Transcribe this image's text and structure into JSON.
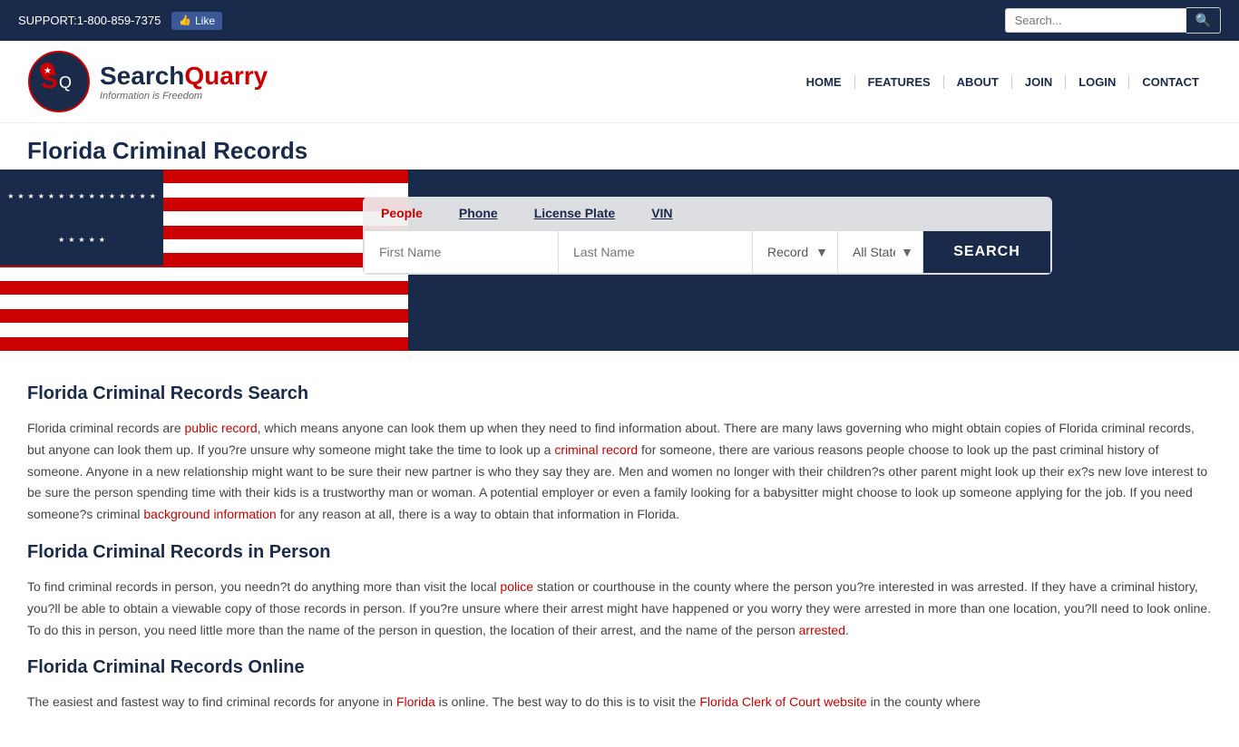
{
  "topbar": {
    "support_text": "SUPPORT:1-800-859-7375",
    "fb_like_label": "Like",
    "search_placeholder": "Search..."
  },
  "header": {
    "logo_title_part1": "Search",
    "logo_title_part2": "Quarry",
    "logo_subtitle": "Information is Freedom",
    "nav": [
      {
        "label": "HOME",
        "id": "home"
      },
      {
        "label": "FEATURES",
        "id": "features"
      },
      {
        "label": "ABOUT",
        "id": "about"
      },
      {
        "label": "JOIN",
        "id": "join"
      },
      {
        "label": "LOGIN",
        "id": "login"
      },
      {
        "label": "CONTACT",
        "id": "contact"
      }
    ]
  },
  "page": {
    "title": "Florida Criminal Records"
  },
  "search_widget": {
    "tabs": [
      {
        "label": "People",
        "id": "people",
        "active": true
      },
      {
        "label": "Phone",
        "id": "phone",
        "active": false
      },
      {
        "label": "License Plate",
        "id": "license-plate",
        "active": false
      },
      {
        "label": "VIN",
        "id": "vin",
        "active": false
      }
    ],
    "first_name_placeholder": "First Name",
    "last_name_placeholder": "Last Name",
    "record_type_label": "Record Type",
    "all_states_label": "All States",
    "search_button_label": "SEARCH"
  },
  "content": {
    "section1_heading": "Florida Criminal Records Search",
    "section1_p1_before": "Florida criminal records are ",
    "section1_p1_link1": "public record",
    "section1_p1_after": ", which means anyone can look them up when they need to find information about. There are many laws governing who might obtain copies of Florida criminal records, but anyone can look them up. If you?re unsure why someone might take the time to look up a ",
    "section1_p1_link2": "criminal record",
    "section1_p1_after2": " for someone, there are various reasons people choose to look up the past criminal history of someone. Anyone in a new relationship might want to be sure their new partner is who they say they are. Men and women no longer with their children?s other parent might look up their ex?s new love interest to be sure the person spending time with their kids is a trustworthy man or woman. A potential employer or even a family looking for a babysitter might choose to look up someone applying for the job. If you need someone?s criminal ",
    "section1_p1_link3": "background information",
    "section1_p1_after3": " for any reason at all, there is a way to obtain that information in Florida.",
    "section2_heading": "Florida Criminal Records in Person",
    "section2_p1_before": "To find criminal records in person, you needn?t do anything more than visit the local ",
    "section2_p1_link1": "police",
    "section2_p1_after": " station or courthouse in the county where the person you?re interested in was arrested. If they have a criminal history, you?ll be able to obtain a viewable copy of those records in person. If you?re unsure where their arrest might have happened or you worry they were arrested in more than one location, you?ll need to look online. To do this in person, you need little more than the name of the person in question, the location of their arrest, and the name of the person ",
    "section2_p1_link2": "arrested",
    "section2_p1_after2": ".",
    "section3_heading": "Florida Criminal Records Online",
    "section3_p1_before": "The easiest and fastest way to find criminal records for anyone in ",
    "section3_p1_link1": "Florida",
    "section3_p1_after": " is online. The best way to do this is to visit the ",
    "section3_p1_link2": "Florida Clerk of Court website",
    "section3_p1_after2": " in the county where"
  }
}
